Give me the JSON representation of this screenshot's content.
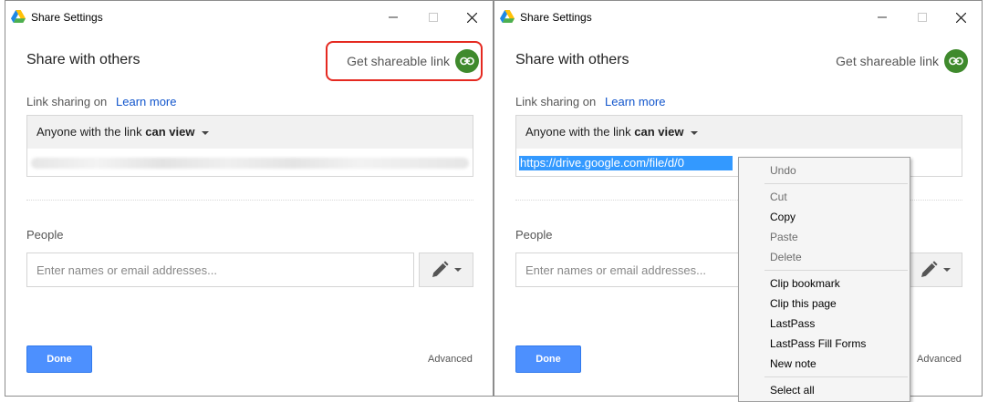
{
  "windows": [
    {
      "title": "Share Settings",
      "heading": "Share with others",
      "get_link_label": "Get shareable link",
      "link_sharing_label": "Link sharing on",
      "learn_more": "Learn more",
      "access_prefix": "Anyone with the link ",
      "access_level": "can view",
      "url_value": "",
      "people_label": "People",
      "people_placeholder": "Enter names or email addresses...",
      "done_label": "Done",
      "advanced_label": "Advanced",
      "get_link_highlighted": true
    },
    {
      "title": "Share Settings",
      "heading": "Share with others",
      "get_link_label": "Get shareable link",
      "link_sharing_label": "Link sharing on",
      "learn_more": "Learn more",
      "access_prefix": "Anyone with the link ",
      "access_level": "can view",
      "url_value": "https://drive.google.com/file/d/0",
      "people_label": "People",
      "people_placeholder": "Enter names or email addresses...",
      "done_label": "Done",
      "advanced_label": "Advanced",
      "get_link_highlighted": false
    }
  ],
  "context_menu": {
    "items": [
      {
        "label": "Undo",
        "disabled": true
      },
      {
        "label": "Cut",
        "disabled": true
      },
      {
        "label": "Copy",
        "disabled": false
      },
      {
        "label": "Paste",
        "disabled": true
      },
      {
        "label": "Delete",
        "disabled": true
      },
      {
        "label": "Clip bookmark",
        "disabled": false
      },
      {
        "label": "Clip this page",
        "disabled": false
      },
      {
        "label": "LastPass",
        "disabled": false
      },
      {
        "label": "LastPass Fill Forms",
        "disabled": false
      },
      {
        "label": "New note",
        "disabled": false
      },
      {
        "label": "Select all",
        "disabled": false
      }
    ]
  },
  "colors": {
    "link_icon_green": "#3f8a2d",
    "done_blue": "#4d90fe",
    "highlight_red": "#e52920",
    "learn_more_blue": "#1155cc",
    "selection_blue": "#3399ff"
  },
  "icons": {
    "app": "google-drive-icon",
    "link": "link-icon",
    "edit": "pencil-icon"
  }
}
